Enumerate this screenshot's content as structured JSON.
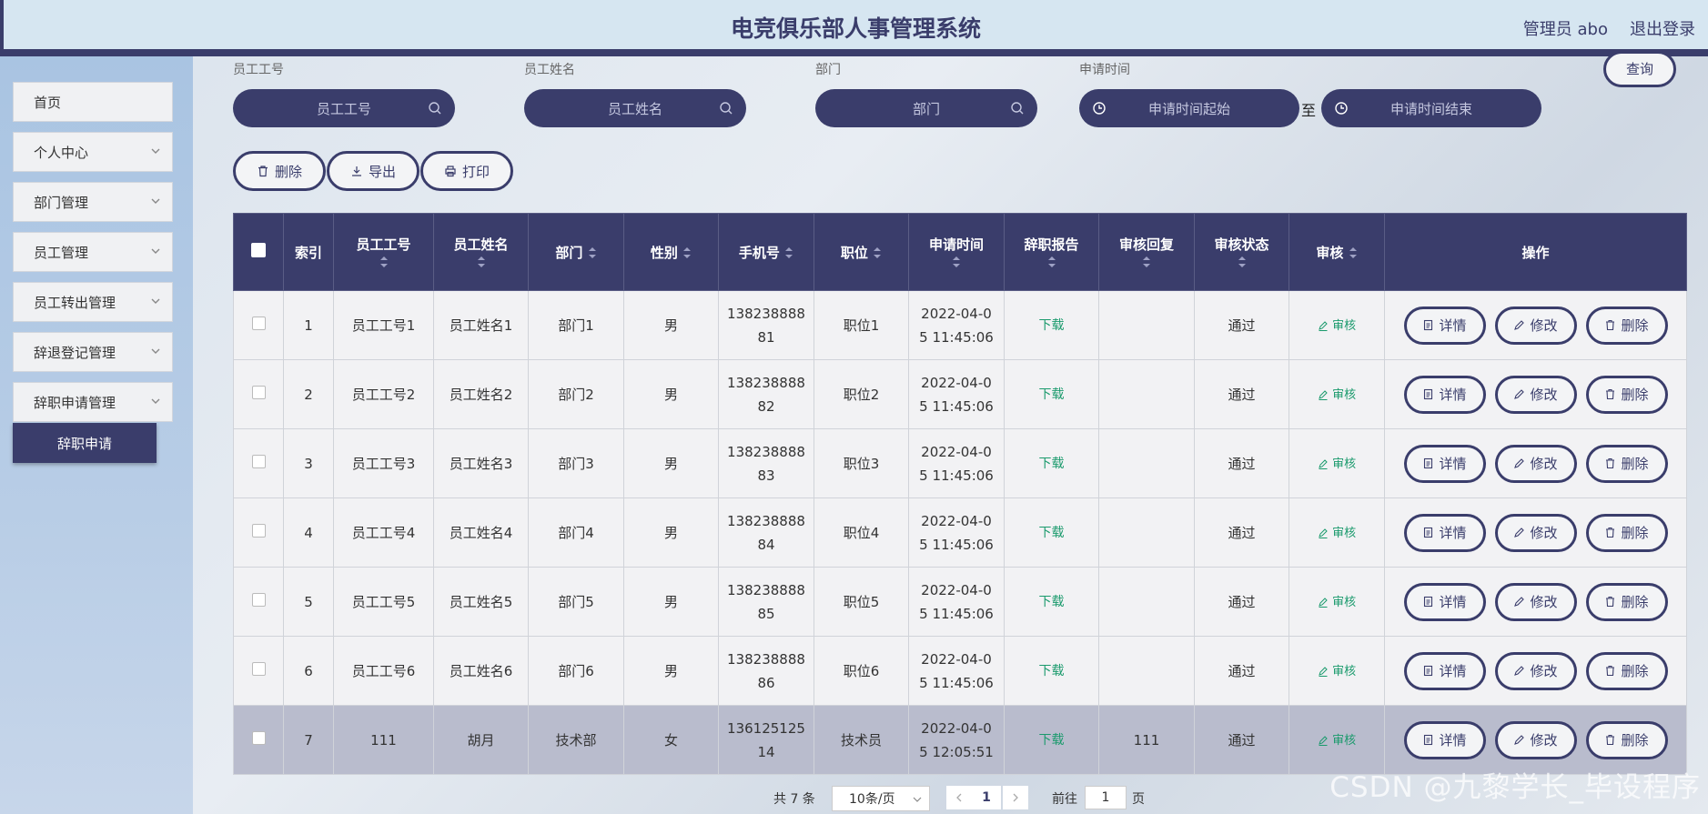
{
  "header": {
    "title": "电竞俱乐部人事管理系统",
    "user": "管理员 abo",
    "logout": "退出登录"
  },
  "sidebar": {
    "items": [
      {
        "label": "首页",
        "expandable": false
      },
      {
        "label": "个人中心",
        "expandable": true
      },
      {
        "label": "部门管理",
        "expandable": true
      },
      {
        "label": "员工管理",
        "expandable": true
      },
      {
        "label": "员工转出管理",
        "expandable": true
      },
      {
        "label": "辞退登记管理",
        "expandable": true
      },
      {
        "label": "辞职申请管理",
        "expandable": true
      }
    ],
    "submenu_active": "辞职申请"
  },
  "search": {
    "fields": [
      {
        "label": "员工工号",
        "placeholder": "员工工号"
      },
      {
        "label": "员工姓名",
        "placeholder": "员工姓名"
      },
      {
        "label": "部门",
        "placeholder": "部门"
      },
      {
        "label": "申请时间"
      }
    ],
    "date_start_placeholder": "申请时间起始",
    "date_end_placeholder": "申请时间结束",
    "date_separator": "至",
    "query_label": "查询"
  },
  "actions": {
    "delete": "删除",
    "export": "导出",
    "print": "打印"
  },
  "table": {
    "headers": {
      "index": "索引",
      "emp_no": "员工工号",
      "emp_name": "员工姓名",
      "dept": "部门",
      "gender": "性别",
      "phone": "手机号",
      "position": "职位",
      "apply_time": "申请时间",
      "report": "辞职报告",
      "reply": "审核回复",
      "status": "审核状态",
      "audit": "审核",
      "ops": "操作"
    },
    "rows": [
      {
        "index": "1",
        "emp_no": "员工工号1",
        "emp_name": "员工姓名1",
        "dept": "部门1",
        "gender": "男",
        "phone_a": "138238888",
        "phone_b": "81",
        "position": "职位1",
        "time_a": "2022-04-0",
        "time_b": "5 11:45:06",
        "report": "下载",
        "reply": "",
        "status": "通过",
        "audit": "审核"
      },
      {
        "index": "2",
        "emp_no": "员工工号2",
        "emp_name": "员工姓名2",
        "dept": "部门2",
        "gender": "男",
        "phone_a": "138238888",
        "phone_b": "82",
        "position": "职位2",
        "time_a": "2022-04-0",
        "time_b": "5 11:45:06",
        "report": "下载",
        "reply": "",
        "status": "通过",
        "audit": "审核"
      },
      {
        "index": "3",
        "emp_no": "员工工号3",
        "emp_name": "员工姓名3",
        "dept": "部门3",
        "gender": "男",
        "phone_a": "138238888",
        "phone_b": "83",
        "position": "职位3",
        "time_a": "2022-04-0",
        "time_b": "5 11:45:06",
        "report": "下载",
        "reply": "",
        "status": "通过",
        "audit": "审核"
      },
      {
        "index": "4",
        "emp_no": "员工工号4",
        "emp_name": "员工姓名4",
        "dept": "部门4",
        "gender": "男",
        "phone_a": "138238888",
        "phone_b": "84",
        "position": "职位4",
        "time_a": "2022-04-0",
        "time_b": "5 11:45:06",
        "report": "下载",
        "reply": "",
        "status": "通过",
        "audit": "审核"
      },
      {
        "index": "5",
        "emp_no": "员工工号5",
        "emp_name": "员工姓名5",
        "dept": "部门5",
        "gender": "男",
        "phone_a": "138238888",
        "phone_b": "85",
        "position": "职位5",
        "time_a": "2022-04-0",
        "time_b": "5 11:45:06",
        "report": "下载",
        "reply": "",
        "status": "通过",
        "audit": "审核"
      },
      {
        "index": "6",
        "emp_no": "员工工号6",
        "emp_name": "员工姓名6",
        "dept": "部门6",
        "gender": "男",
        "phone_a": "138238888",
        "phone_b": "86",
        "position": "职位6",
        "time_a": "2022-04-0",
        "time_b": "5 11:45:06",
        "report": "下载",
        "reply": "",
        "status": "通过",
        "audit": "审核"
      },
      {
        "index": "7",
        "emp_no": "111",
        "emp_name": "胡月",
        "dept": "技术部",
        "gender": "女",
        "phone_a": "136125125",
        "phone_b": "14",
        "position": "技术员",
        "time_a": "2022-04-0",
        "time_b": "5 12:05:51",
        "report": "下载",
        "reply": "111",
        "status": "通过",
        "audit": "审核"
      }
    ],
    "row_actions": {
      "detail": "详情",
      "edit": "修改",
      "delete": "删除"
    }
  },
  "pagination": {
    "total": "共 7 条",
    "page_size": "10条/页",
    "current": "1",
    "goto": "前往",
    "goto_value": "1",
    "page_suffix": "页"
  },
  "watermark": "CSDN @九黎学长_毕设程序",
  "colors": {
    "primary": "#3a3d6b",
    "download_green": "#1a9a6c",
    "highlight_row": "#b9bccd"
  }
}
